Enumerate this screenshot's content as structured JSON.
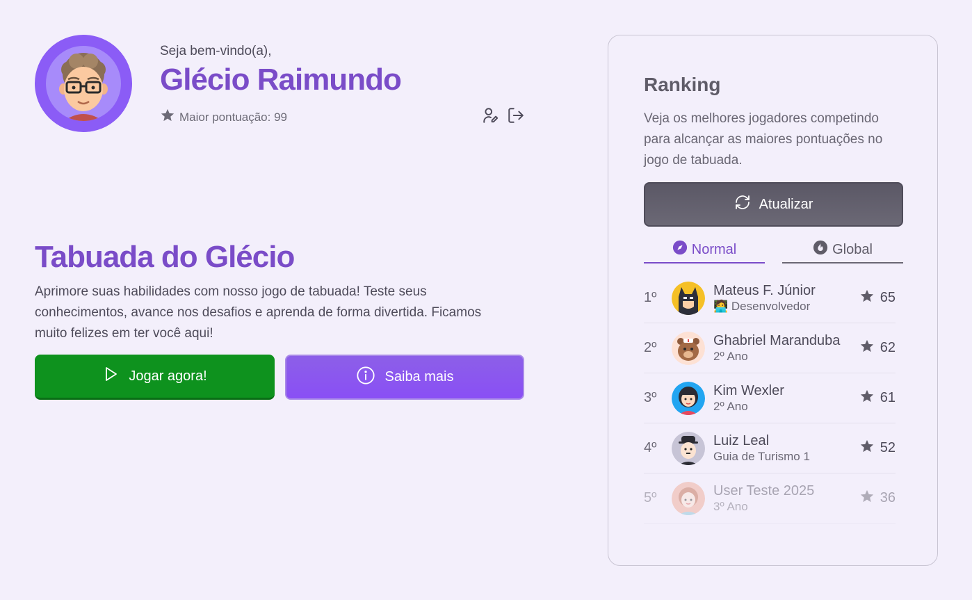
{
  "profile": {
    "welcome": "Seja bem-vindo(a),",
    "name": "Glécio Raimundo",
    "high_score_label": "Maior pontuação: 99"
  },
  "hero": {
    "title": "Tabuada do Glécio",
    "description": "Aprimore suas habilidades com nosso jogo de tabuada! Teste seus conhecimentos, avance nos desafios e aprenda de forma divertida. Ficamos muito felizes em ter você aqui!",
    "play_label": "Jogar agora!",
    "info_label": "Saiba mais"
  },
  "ranking": {
    "title": "Ranking",
    "description": "Veja os melhores jogadores competindo para alcançar as maiores pontuações no jogo de tabuada.",
    "refresh_label": "Atualizar",
    "tabs": [
      {
        "label": "Normal",
        "icon": "compass-icon",
        "active": true
      },
      {
        "label": "Global",
        "icon": "flame-icon",
        "active": false
      }
    ],
    "players": [
      {
        "position": "1º",
        "name": "Mateus F. Júnior",
        "subtitle": "🧑‍💻 Desenvolvedor",
        "score": "65",
        "avatar": "batman-avatar"
      },
      {
        "position": "2º",
        "name": "Ghabriel Maranduba",
        "subtitle": "2º Ano",
        "score": "62",
        "avatar": "bear-avatar"
      },
      {
        "position": "3º",
        "name": "Kim Wexler",
        "subtitle": "2º Ano",
        "score": "61",
        "avatar": "woman-avatar"
      },
      {
        "position": "4º",
        "name": "Luiz Leal",
        "subtitle": "Guia de Turismo 1",
        "score": "52",
        "avatar": "chaplin-avatar"
      },
      {
        "position": "5º",
        "name": "User Teste 2025",
        "subtitle": "3º Ano",
        "score": "36",
        "avatar": "girl-avatar"
      }
    ]
  },
  "colors": {
    "background": "#f3effb",
    "accent": "#7a4cc8",
    "play_button": "#0e921e",
    "info_button": "#8a4ff5",
    "refresh_button": "#5f5c6b"
  }
}
